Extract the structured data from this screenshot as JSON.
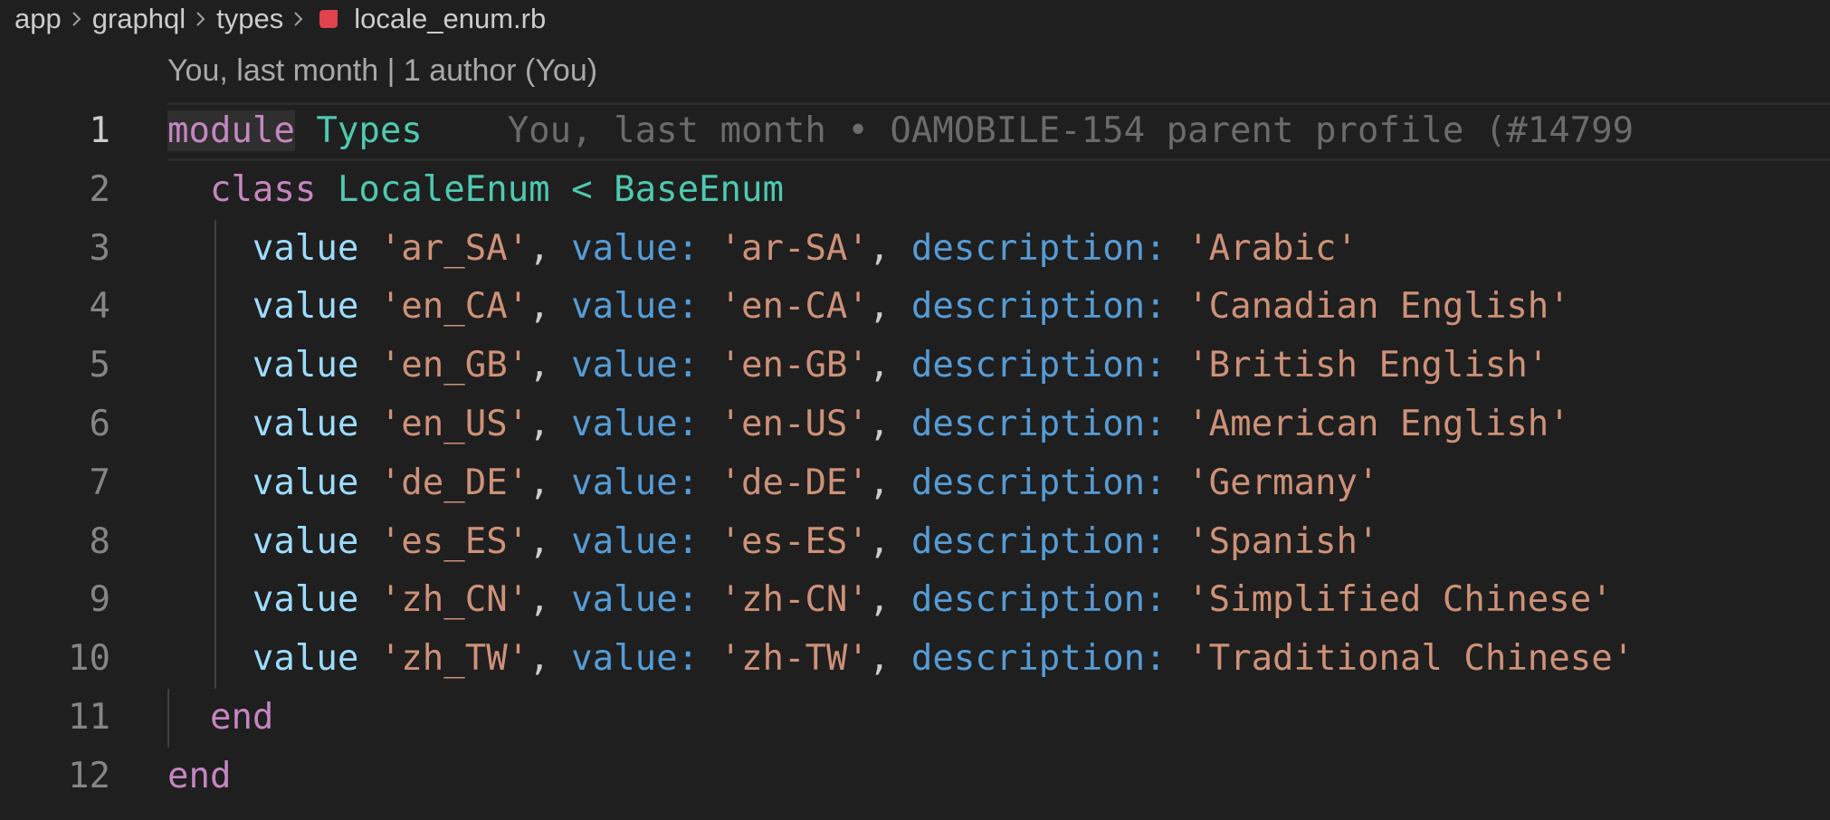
{
  "breadcrumb": {
    "items": [
      "app",
      "graphql",
      "types"
    ],
    "file": "locale_enum.rb",
    "file_icon": "ruby-icon"
  },
  "blame": {
    "header": "You, last month | 1 author (You)",
    "inline": "You, last month • OAMOBILE-154 parent profile (#14799"
  },
  "editor": {
    "current_line": 1,
    "line_numbers": [
      "1",
      "2",
      "3",
      "4",
      "5",
      "6",
      "7",
      "8",
      "9",
      "10",
      "11",
      "12"
    ],
    "module_kw": "module",
    "module_name": "Types",
    "class_kw": "class",
    "class_name": "LocaleEnum",
    "inherit_op": "<",
    "base_class": "BaseEnum",
    "value_method": "value",
    "value_key": "value:",
    "description_key": "description:",
    "values": [
      {
        "name": "'ar_SA'",
        "value": "'ar-SA'",
        "description": "'Arabic'"
      },
      {
        "name": "'en_CA'",
        "value": "'en-CA'",
        "description": "'Canadian English'"
      },
      {
        "name": "'en_GB'",
        "value": "'en-GB'",
        "description": "'British English'"
      },
      {
        "name": "'en_US'",
        "value": "'en-US'",
        "description": "'American English'"
      },
      {
        "name": "'de_DE'",
        "value": "'de-DE'",
        "description": "'Germany'"
      },
      {
        "name": "'es_ES'",
        "value": "'es-ES'",
        "description": "'Spanish'"
      },
      {
        "name": "'zh_CN'",
        "value": "'zh-CN'",
        "description": "'Simplified Chinese'"
      },
      {
        "name": "'zh_TW'",
        "value": "'zh-TW'",
        "description": "'Traditional Chinese'"
      }
    ],
    "end_kw": "end"
  },
  "colors": {
    "background": "#1f1f1f",
    "keyword": "#c586c0",
    "type": "#4ec9b0",
    "method": "#9cdcfe",
    "string": "#ce9178",
    "symbol_key": "#569cd6",
    "line_number": "#858585",
    "ruby_icon": "#e0434b"
  }
}
